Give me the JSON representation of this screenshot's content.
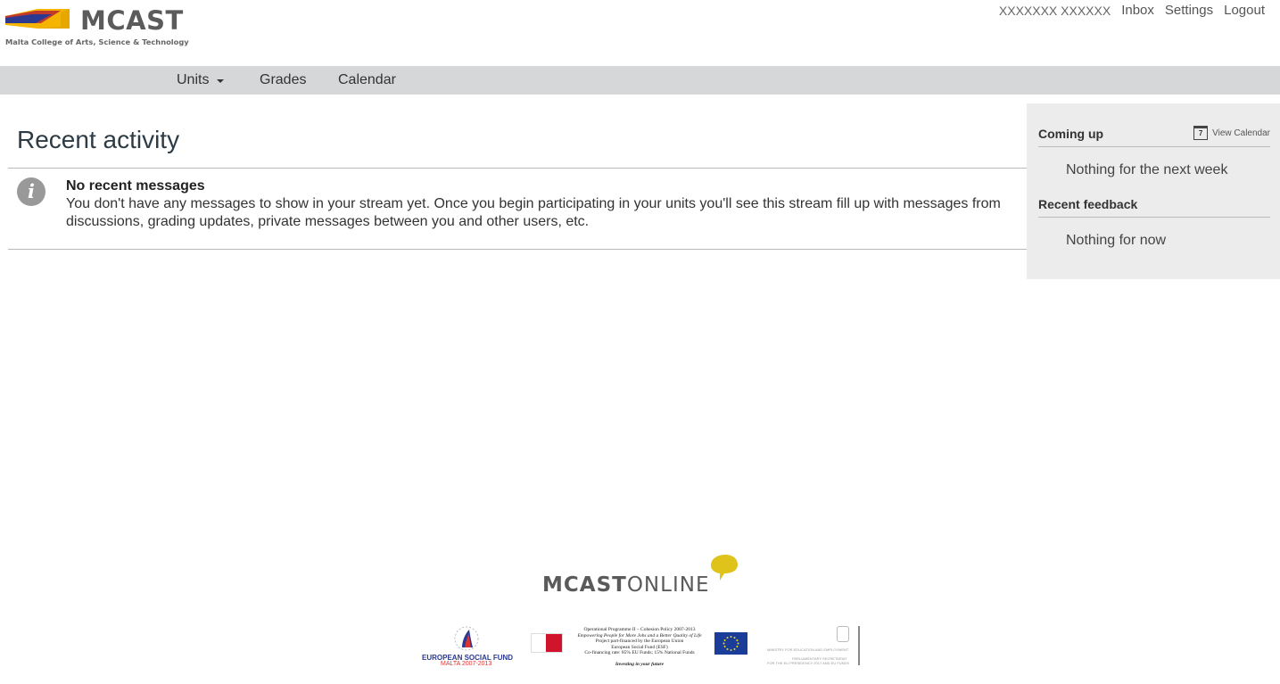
{
  "header": {
    "logo_word": "MCAST",
    "logo_tagline": "Malta College of Arts, Science & Technology",
    "user_name": "XXXXXXX XXXXXX",
    "links": [
      "Inbox",
      "Settings",
      "Logout"
    ]
  },
  "nav": {
    "items": [
      "Units",
      "Grades",
      "Calendar"
    ]
  },
  "main": {
    "title": "Recent activity",
    "message_title": "No recent messages",
    "message_body": "You don't have any messages to show in your stream yet. Once you begin participating in your units you'll see this stream fill up with messages from discussions, grading updates, private messages between you and other users, etc."
  },
  "aside": {
    "coming_up_heading": "Coming up",
    "view_calendar": "View Calendar",
    "calendar_icon_day": "7",
    "coming_up_empty": "Nothing for the next week",
    "feedback_heading": "Recent feedback",
    "feedback_empty": "Nothing for now"
  },
  "footer": {
    "brand_bold": "MCAST",
    "brand_light": "ONLINE",
    "esf_label": "EUROPEAN SOCIAL FUND",
    "esf_sub": "MALTA 2007-2013",
    "op_lines": [
      "Operational Programme II – Cohesion Policy 2007-2013",
      "Empowering People for More Jobs and a Better Quality of Life",
      "Project part-financed by the European Union",
      "European Social Fund (ESF)",
      "Co-financing rate: 85% EU Funds; 15% National Funds"
    ],
    "op_tagline": "Investing in your future",
    "ministry_line1": "MINISTRY FOR EDUCATION AND EMPLOYMENT",
    "ministry_line2": "PARLIAMENTARY SECRETARIAT",
    "ministry_line3": "FOR THE EU PRESIDENCY 2017 AND EU FUNDS"
  },
  "colors": {
    "nav_bg": "#d6d7d9",
    "aside_bg": "#ececec",
    "logo_blue": "#2b3990",
    "logo_red": "#c0392b",
    "logo_yellow": "#f4b400",
    "bubble_yellow": "#e0c31a"
  }
}
